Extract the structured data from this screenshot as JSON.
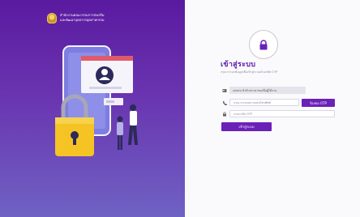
{
  "brand": {
    "line1": "สำนักงานคณะกรรมการส่งเสริม",
    "line2": "และพัฒนาบุคลากรอุตสาหกรรม"
  },
  "login": {
    "title": "เข้าสู่ระบบ",
    "subtitle": "กรุณากรอกข้อมูลเพื่อเข้าสู่ระบบด้วยรหัส OTP",
    "id_value": "เลขประจำตัวประชาชน/ชื่อผู้ใช้งาน",
    "phone_placeholder": "กรุณากรอกหมายเลขโทรศัพท์",
    "otp_button": "ร้องขอ OTP",
    "otp_placeholder": "กรอกรหัส OTP",
    "login_button": "เข้าสู่ระบบ"
  },
  "icons": {
    "header": "lock-icon",
    "id_row": "id-card-icon",
    "phone_row": "phone-icon",
    "otp_row": "padlock-icon"
  },
  "colors": {
    "accent": "#6b21b8",
    "panel_top": "#5a1aa0",
    "panel_bottom": "#6f62c4"
  }
}
